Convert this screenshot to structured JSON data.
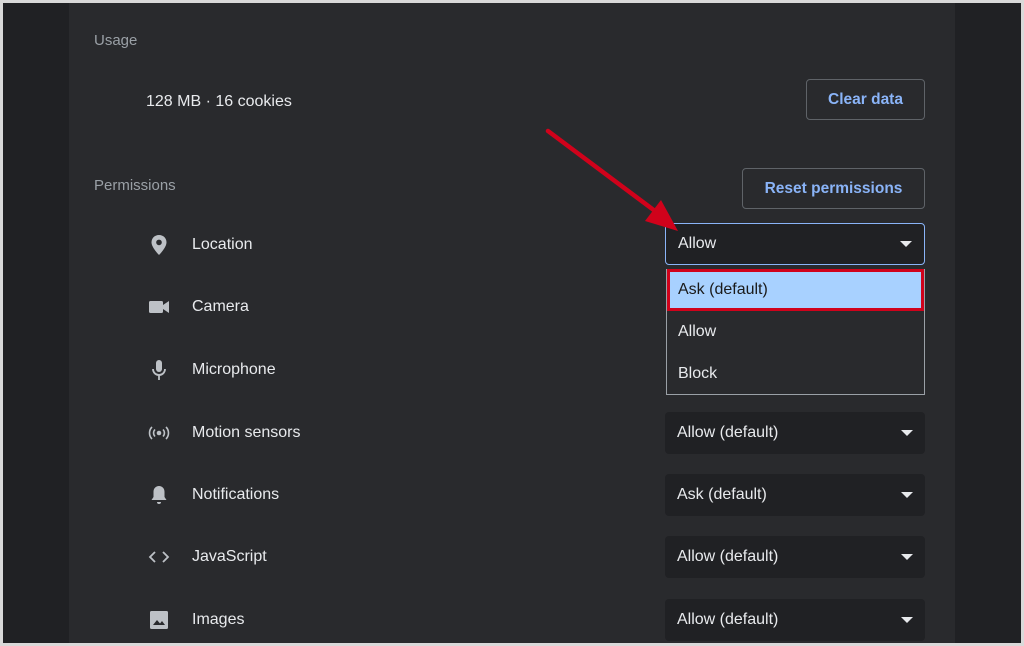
{
  "usage": {
    "title": "Usage",
    "summary": "128 MB · 16 cookies",
    "clear_button": "Clear data"
  },
  "permissions": {
    "title": "Permissions",
    "reset_button": "Reset permissions",
    "rows": [
      {
        "label": "Location",
        "icon": "location-pin-icon",
        "value": "Allow"
      },
      {
        "label": "Camera",
        "icon": "camera-icon",
        "value": ""
      },
      {
        "label": "Microphone",
        "icon": "microphone-icon",
        "value": ""
      },
      {
        "label": "Motion sensors",
        "icon": "motion-sensors-icon",
        "value": "Allow (default)"
      },
      {
        "label": "Notifications",
        "icon": "bell-icon",
        "value": "Ask (default)"
      },
      {
        "label": "JavaScript",
        "icon": "code-brackets-icon",
        "value": "Allow (default)"
      },
      {
        "label": "Images",
        "icon": "image-icon",
        "value": "Allow (default)"
      }
    ]
  },
  "dropdown": {
    "options": [
      "Ask (default)",
      "Allow",
      "Block"
    ],
    "highlighted": "Ask (default)"
  },
  "colors": {
    "background": "#202124",
    "panel": "#292a2d",
    "accent": "#8ab4f8",
    "highlight": "#a8d1ff",
    "annotation_red": "#d0021b"
  }
}
